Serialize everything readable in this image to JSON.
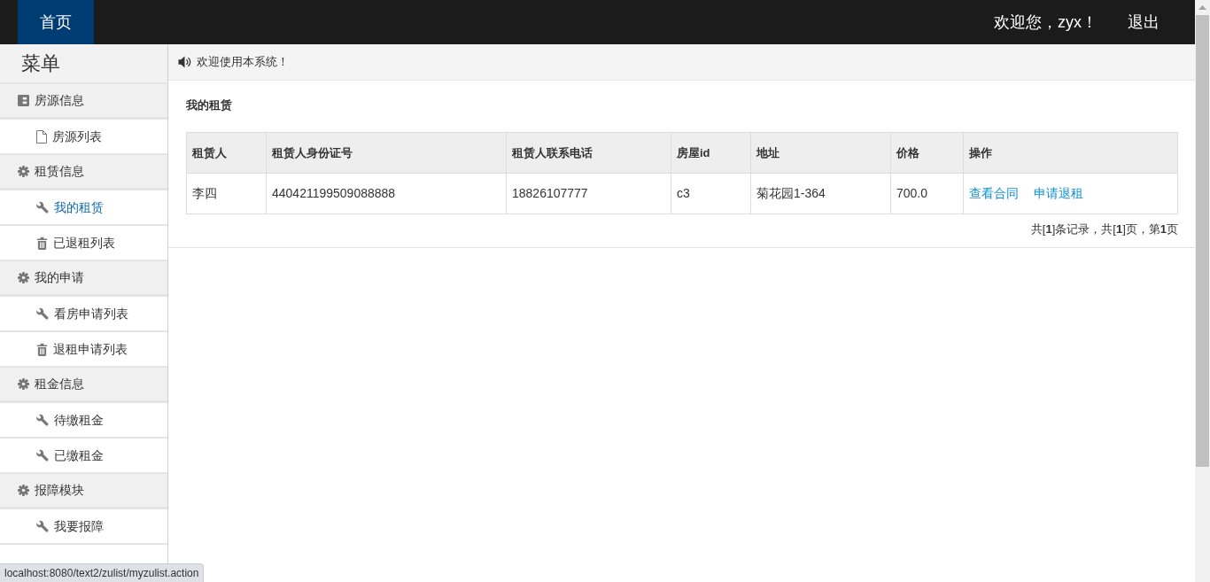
{
  "navbar": {
    "items": [
      {
        "label": "首页",
        "selected": true
      }
    ],
    "greeting": "欢迎您，zyx！",
    "logout": "退出"
  },
  "sidebar": {
    "title": "菜单",
    "groups": [
      {
        "label": "房源信息",
        "kind": "tile",
        "items": [
          {
            "label": "房源列表",
            "kind": "file",
            "selected": false
          }
        ]
      },
      {
        "label": "租赁信息",
        "kind": "gear",
        "items": [
          {
            "label": "我的租赁",
            "kind": "wrench",
            "selected": true
          },
          {
            "label": "已退租列表",
            "kind": "trash",
            "selected": false
          }
        ]
      },
      {
        "label": "我的申请",
        "kind": "gear",
        "items": [
          {
            "label": "看房申请列表",
            "kind": "wrench",
            "selected": false
          },
          {
            "label": "退租申请列表",
            "kind": "trash",
            "selected": false
          }
        ]
      },
      {
        "label": "租金信息",
        "kind": "gear",
        "items": [
          {
            "label": "待缴租金",
            "kind": "wrench",
            "selected": false
          },
          {
            "label": "已缴租金",
            "kind": "wrench",
            "selected": false
          }
        ]
      },
      {
        "label": "报障模块",
        "kind": "gear",
        "items": [
          {
            "label": "我要报障",
            "kind": "wrench",
            "selected": false
          }
        ]
      }
    ]
  },
  "notice": {
    "text": "欢迎使用本系统！"
  },
  "panel": {
    "title": "我的租赁",
    "table": {
      "columns": [
        "租赁人",
        "租赁人身份证号",
        "租赁人联系电话",
        "房屋id",
        "地址",
        "价格",
        "操作"
      ],
      "rows": [
        {
          "cells": [
            "李四",
            "440421199509088888",
            "18826107777",
            "c3",
            "菊花园1-364",
            "700.0"
          ],
          "actions": [
            "查看合同",
            "申请退租"
          ]
        }
      ]
    },
    "pagination": "共[**1**]条记录，共[**1**]页，第**1**页"
  },
  "status_bar": {
    "url": "localhost:8080/text2/zulist/myzulist.action"
  }
}
